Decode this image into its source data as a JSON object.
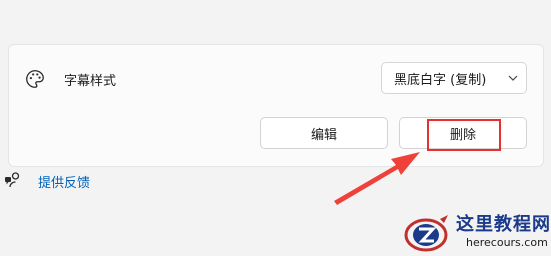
{
  "caption_setting": {
    "label": "字幕样式",
    "selected_style": "黑底白字 (复制)",
    "edit_label": "编辑",
    "delete_label": "删除"
  },
  "feedback": {
    "label": "提供反馈"
  },
  "icons": {
    "caption": "palette-icon",
    "dropdown": "chevron-down-icon",
    "feedback": "feedback-icon"
  },
  "annotation": {
    "highlight_color": "#e8302d",
    "target": "delete-button"
  },
  "watermark": {
    "title": "这里教程网",
    "url": "herecours.com"
  }
}
